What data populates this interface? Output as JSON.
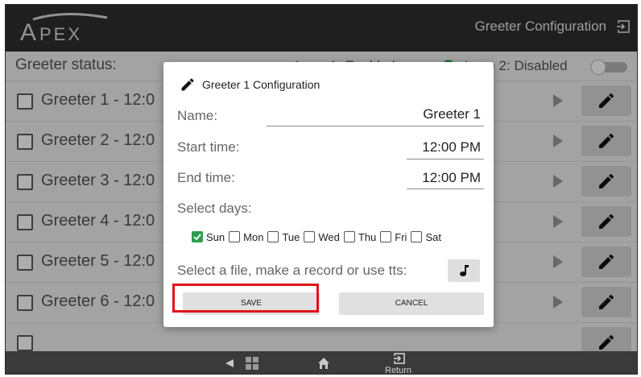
{
  "header": {
    "logo_text": "APEX",
    "title": "Greeter Configuration",
    "exit_icon": "exit-to-app-icon"
  },
  "status": {
    "label": "Greeter status:",
    "lane1": "Lane 1: Enabled",
    "lane1_on": true,
    "lane2": "Lane 2: Disabled",
    "lane2_on": false
  },
  "greeters": [
    {
      "label": "Greeter 1 - 12:0"
    },
    {
      "label": "Greeter 2 - 12:0"
    },
    {
      "label": "Greeter 3 - 12:0"
    },
    {
      "label": "Greeter 4 - 12:0"
    },
    {
      "label": "Greeter 5 - 12:0"
    },
    {
      "label": "Greeter 6 - 12:0"
    }
  ],
  "dialog": {
    "title": "Greeter 1 Configuration",
    "name_label": "Name:",
    "name_value": "Greeter 1",
    "start_label": "Start time:",
    "start_value": "12:00 PM",
    "end_label": "End time:",
    "end_value": "12:00 PM",
    "days_label": "Select days:",
    "days": [
      {
        "label": "Sun",
        "checked": true
      },
      {
        "label": "Mon",
        "checked": false
      },
      {
        "label": "Tue",
        "checked": false
      },
      {
        "label": "Wed",
        "checked": false
      },
      {
        "label": "Thu",
        "checked": false
      },
      {
        "label": "Fri",
        "checked": false
      },
      {
        "label": "Sat",
        "checked": false
      }
    ],
    "file_label": "Select a file, make a record or use tts:",
    "save_label": "SAVE",
    "cancel_label": "CANCEL"
  },
  "navbar": {
    "return_label": "Return"
  },
  "colors": {
    "header_bg": "#2f2f2f",
    "toggle_on": "#2e9e4e",
    "highlight": "#e0141b"
  }
}
